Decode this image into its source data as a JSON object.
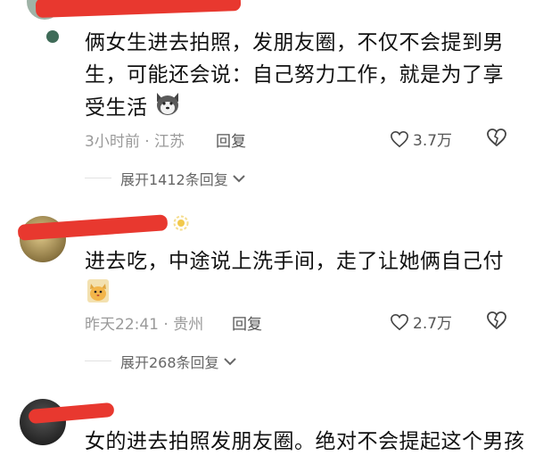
{
  "comments": [
    {
      "text": "俩女生进去拍照，发朋友圈，不仅不会提到男生，可能还会说：自己努力工作，就是为了享受生活",
      "emoji": "husky-face-emoji",
      "time": "3小时前",
      "location": "江苏",
      "reply_label": "回复",
      "likes": "3.7万",
      "expand_label": "展开1412条回复"
    },
    {
      "text": "进去吃，中途说上洗手间，走了让她俩自己付",
      "emoji": "cat-face-emoji",
      "time": "昨天22:41",
      "location": "贵州",
      "reply_label": "回复",
      "likes": "2.7万",
      "expand_label": "展开268条回复"
    },
    {
      "text": "女的进去拍照发朋友圈。绝对不会提起这个男孩",
      "emoji": "",
      "time": "",
      "location": "",
      "reply_label": "",
      "likes": "",
      "expand_label": ""
    }
  ],
  "separator": " · ",
  "colors": {
    "redaction": "#e8382f",
    "meta_gray": "#9a9a9a",
    "text": "#111111"
  },
  "icons": [
    "heart-outline-icon",
    "dislike-heart-icon",
    "chevron-down-icon"
  ]
}
